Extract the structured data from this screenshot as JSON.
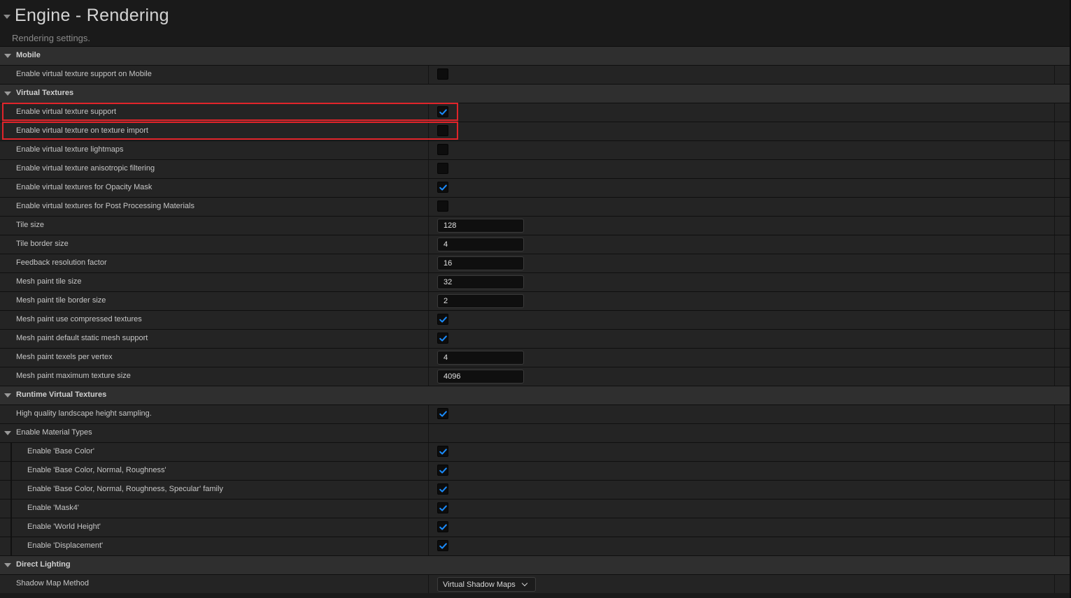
{
  "header": {
    "title": "Engine - Rendering",
    "subtitle": "Rendering settings."
  },
  "colors": {
    "accent_check": "#1a8cff",
    "highlight_border": "#e0242a"
  },
  "rows": [
    {
      "kind": "category",
      "label": "Mobile"
    },
    {
      "kind": "property",
      "label": "Enable virtual texture support on Mobile",
      "control": "checkbox",
      "checked": false
    },
    {
      "kind": "category",
      "label": "Virtual Textures"
    },
    {
      "kind": "property",
      "label": "Enable virtual texture support",
      "control": "checkbox",
      "checked": true,
      "highlighted": true
    },
    {
      "kind": "property",
      "label": "Enable virtual texture on texture import",
      "control": "checkbox",
      "checked": false,
      "highlighted": true
    },
    {
      "kind": "property",
      "label": "Enable virtual texture lightmaps",
      "control": "checkbox",
      "checked": false
    },
    {
      "kind": "property",
      "label": "Enable virtual texture anisotropic filtering",
      "control": "checkbox",
      "checked": false
    },
    {
      "kind": "property",
      "label": "Enable virtual textures for Opacity Mask",
      "control": "checkbox",
      "checked": true
    },
    {
      "kind": "property",
      "label": "Enable virtual textures for Post Processing Materials",
      "control": "checkbox",
      "checked": false
    },
    {
      "kind": "property",
      "label": "Tile size",
      "control": "number",
      "value": "128"
    },
    {
      "kind": "property",
      "label": "Tile border size",
      "control": "number",
      "value": "4"
    },
    {
      "kind": "property",
      "label": "Feedback resolution factor",
      "control": "number",
      "value": "16"
    },
    {
      "kind": "property",
      "label": "Mesh paint tile size",
      "control": "number",
      "value": "32"
    },
    {
      "kind": "property",
      "label": "Mesh paint tile border size",
      "control": "number",
      "value": "2"
    },
    {
      "kind": "property",
      "label": "Mesh paint use compressed textures",
      "control": "checkbox",
      "checked": true
    },
    {
      "kind": "property",
      "label": "Mesh paint default static mesh support",
      "control": "checkbox",
      "checked": true
    },
    {
      "kind": "property",
      "label": "Mesh paint texels per vertex",
      "control": "number",
      "value": "4"
    },
    {
      "kind": "property",
      "label": "Mesh paint maximum texture size",
      "control": "number",
      "value": "4096"
    },
    {
      "kind": "category",
      "label": "Runtime Virtual Textures"
    },
    {
      "kind": "property",
      "label": "High quality landscape height sampling.",
      "control": "checkbox",
      "checked": true
    },
    {
      "kind": "subcategory",
      "label": "Enable Material Types"
    },
    {
      "kind": "property",
      "indented": true,
      "label": "Enable 'Base Color'",
      "control": "checkbox",
      "checked": true
    },
    {
      "kind": "property",
      "indented": true,
      "label": "Enable 'Base Color, Normal, Roughness'",
      "control": "checkbox",
      "checked": true
    },
    {
      "kind": "property",
      "indented": true,
      "label": "Enable 'Base Color, Normal, Roughness, Specular' family",
      "control": "checkbox",
      "checked": true
    },
    {
      "kind": "property",
      "indented": true,
      "label": "Enable 'Mask4'",
      "control": "checkbox",
      "checked": true
    },
    {
      "kind": "property",
      "indented": true,
      "label": "Enable 'World Height'",
      "control": "checkbox",
      "checked": true
    },
    {
      "kind": "property",
      "indented": true,
      "label": "Enable 'Displacement'",
      "control": "checkbox",
      "checked": true
    },
    {
      "kind": "category",
      "label": "Direct Lighting"
    },
    {
      "kind": "property",
      "label": "Shadow Map Method",
      "control": "dropdown",
      "value": "Virtual Shadow Maps"
    }
  ]
}
